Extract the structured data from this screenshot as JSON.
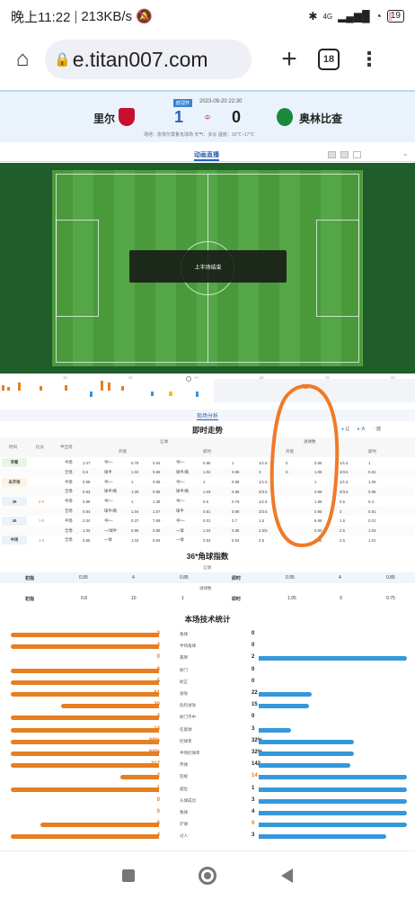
{
  "statusbar": {
    "time": "晚上11:22",
    "speed": "213KB/s",
    "battery": "19",
    "net": "4G"
  },
  "browser": {
    "url": "e.titan007.com",
    "tab_count": "18"
  },
  "match": {
    "badge": "欧冠杯",
    "datetime": "2023-09-20 22:30",
    "home": "里尔",
    "away": "奥林比查",
    "home_score": "1",
    "away_score": "0",
    "mid": "中",
    "info": "场地：皮埃尔莫鲁瓦球场    天气：多云    温度：16℃~17℃",
    "colors": {
      "home": "#c8102e",
      "away": "#1a8a3a"
    }
  },
  "live": {
    "tab_label": "动画直播",
    "overlay_text": "上半场结束"
  },
  "timeline": {
    "ticks": [
      "15'",
      "30'",
      "HT",
      "60'",
      "75'",
      "90'"
    ]
  },
  "analysis_tab": "现场分析",
  "odds": {
    "title": "即时走势",
    "legend": [
      "让",
      "大",
      "欧"
    ],
    "headers": {
      "time": "时间",
      "score": "比分",
      "half": "半全场",
      "ah": "让球",
      "ou": "进球数",
      "open": "开盘",
      "now": "即时"
    },
    "rows": [
      {
        "label": "早餐",
        "a": "半场",
        "v": [
          "1.07",
          "半/一",
          "0.75",
          "0.92",
          "半/一",
          "0.96",
          "1",
          "1/1.5",
          "0.",
          "0.86",
          "1/1.5",
          "1"
        ]
      },
      {
        "label": "",
        "a": "全场",
        "v": [
          "0.6",
          "球半",
          "1.02",
          "0.86",
          "球半/两",
          "1.02",
          "0.95",
          "3",
          "0.",
          "1.05",
          "3/3.5",
          "0.81"
        ]
      },
      {
        "label": "未开场",
        "a": "半场",
        "v": [
          "0.88",
          "半/一",
          "1",
          "0.88",
          "半/一",
          "1",
          "0.88",
          "1/1.5",
          "",
          "1",
          "1/1.5",
          "1.06"
        ]
      },
      {
        "label": "",
        "a": "全场",
        "v": [
          "0.83",
          "球半/两",
          "1.05",
          "0.85",
          "球半/两",
          "1.03",
          "0.86",
          "3/3.5",
          "",
          "0.98",
          "3/3.5",
          "0.88"
        ]
      },
      {
        "label": "39",
        "b": "0-0",
        "a": "半场",
        "v": [
          "0.88",
          "半/一",
          "1",
          "1.38",
          "半/一",
          "0.6",
          "0.79",
          "1/1.5",
          "",
          "1.85",
          "0.5",
          "0.4"
        ]
      },
      {
        "label": "",
        "a": "全场",
        "v": [
          "0.84",
          "球半/两",
          "1.04",
          "1.07",
          "球半",
          "0.81",
          "0.98",
          "3/3.5",
          "",
          "0.95",
          "2",
          "0.91"
        ]
      },
      {
        "label": "45",
        "b": "1-0",
        "a": "半场",
        "v": [
          "2.04",
          "半/一",
          "0.37",
          "7.69",
          "半/一",
          "0.01",
          "2.7",
          "1.5",
          "",
          "6.66",
          "1.5",
          "0.01"
        ]
      },
      {
        "label": "",
        "a": "全场",
        "v": [
          "1.02",
          "一/球半",
          "0.86",
          "0.85",
          "一球",
          "1.03",
          "0.85",
          "2.5/3",
          "",
          "0.83",
          "2.5",
          "1.03"
        ]
      },
      {
        "label": "中场",
        "b": "1-0",
        "a": "全场",
        "v": [
          "0.85",
          "一球",
          "1.03",
          "0.94",
          "一球",
          "0.94",
          "0.83",
          "2.5",
          "",
          "0.85",
          "2.5",
          "1.01"
        ]
      }
    ]
  },
  "corner": {
    "title": "36*角球指数",
    "ah_label": "让球",
    "ou_label": "进球数",
    "row1": {
      "l": "初指",
      "v": [
        "0.95",
        "4",
        "0.85"
      ],
      "r": "即时",
      "w": [
        "0.95",
        "4",
        "0.85"
      ]
    },
    "row2": {
      "l": "初指",
      "v": [
        "0.8",
        "10",
        "1"
      ],
      "r": "即时",
      "w": [
        "1.05",
        "9",
        "0.75"
      ]
    }
  },
  "stats": {
    "title": "本场技术统计",
    "rows": [
      {
        "name": "角球",
        "l": "3",
        "r": "0",
        "lp": 0.5,
        "rp": 0
      },
      {
        "name": "半场角球",
        "l": "3",
        "r": "0",
        "lp": 0.5,
        "rp": 0
      },
      {
        "name": "黄牌",
        "l": "0",
        "r": "2",
        "lp": 0,
        "rp": 1
      },
      {
        "name": "射门",
        "l": "8",
        "r": "0",
        "lp": 0.5,
        "rp": 0
      },
      {
        "name": "射正",
        "l": "5",
        "r": "0",
        "lp": 0.5,
        "rp": 0
      },
      {
        "name": "进攻",
        "l": "61",
        "r": "22",
        "lp": 0.5,
        "rp": 0.18
      },
      {
        "name": "危险进攻",
        "l": "30",
        "r": "15",
        "lp": 0.33,
        "rp": 0.17
      },
      {
        "name": "射门不中",
        "l": "3",
        "r": "0",
        "lp": 0.5,
        "rp": 0
      },
      {
        "name": "任意球",
        "l": "14",
        "r": "3",
        "lp": 0.5,
        "rp": 0.11
      },
      {
        "name": "控球率",
        "l": "68%",
        "r": "32%",
        "lp": 0.68,
        "rp": 0.32
      },
      {
        "name": "半场控球率",
        "l": "68%",
        "r": "32%",
        "lp": 0.68,
        "rp": 0.32
      },
      {
        "name": "传球",
        "l": "317",
        "r": "142",
        "lp": 0.69,
        "rp": 0.31
      },
      {
        "name": "犯规",
        "l": "2",
        "r": "14",
        "lp": 0.13,
        "rp": 0.88
      },
      {
        "name": "越位",
        "l": "1",
        "r": "1",
        "lp": 0.5,
        "rp": 0.5
      },
      {
        "name": "头球成功",
        "l": "0",
        "r": "3",
        "lp": 0,
        "rp": 1
      },
      {
        "name": "救球",
        "l": "0",
        "r": "4",
        "lp": 0,
        "rp": 1
      },
      {
        "name": "铲球",
        "l": "6",
        "r": "9",
        "lp": 0.4,
        "rp": 0.6
      },
      {
        "name": "过人",
        "l": "4",
        "r": "3",
        "lp": 0.57,
        "rp": 0.43
      }
    ]
  }
}
